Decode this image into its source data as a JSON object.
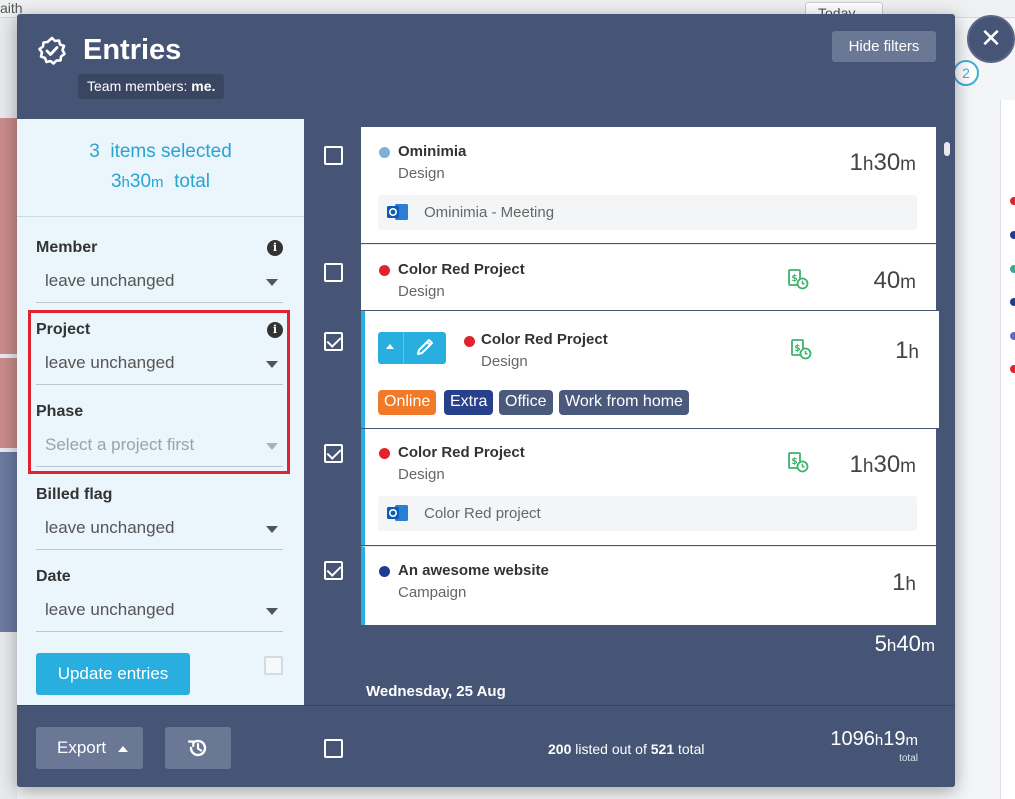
{
  "background": {
    "user_label": "aith",
    "today_label": "Today",
    "badge": "2"
  },
  "modal": {
    "title": "Entries",
    "team_label": "Team members:",
    "team_value": "me.",
    "hide_filters_label": "Hide filters",
    "close_label": "✕"
  },
  "selection": {
    "count": "3",
    "count_label": "items selected",
    "total_h": "3",
    "total_m": "30",
    "total_label": "total"
  },
  "filters": {
    "member": {
      "label": "Member",
      "value": "leave unchanged"
    },
    "project": {
      "label": "Project",
      "value": "leave unchanged"
    },
    "phase": {
      "label": "Phase",
      "placeholder": "Select a project first"
    },
    "billed": {
      "label": "Billed flag",
      "value": "leave unchanged"
    },
    "date": {
      "label": "Date",
      "value": "leave unchanged"
    },
    "update_label": "Update entries"
  },
  "entries": [
    {
      "project": "Ominimia",
      "task": "Design",
      "hours": "1",
      "minutes": "30",
      "color": "#7eb0d9",
      "note": "Ominimia - Meeting",
      "checked": false
    },
    {
      "project": "Color Red Project",
      "task": "Design",
      "hours": "",
      "minutes": "40",
      "color": "#e0232c",
      "checked": false
    },
    {
      "project": "Color Red Project",
      "task": "Design",
      "hours": "1",
      "minutes": "",
      "color": "#e0232c",
      "checked": true,
      "tags": [
        "Online",
        "Extra",
        "Office",
        "Work from home"
      ]
    },
    {
      "project": "Color Red Project",
      "task": "Design",
      "hours": "1",
      "minutes": "30",
      "color": "#e0232c",
      "note": "Color Red project",
      "checked": true
    },
    {
      "project": "An awesome website",
      "task": "Campaign",
      "hours": "1",
      "minutes": "",
      "color": "#1f3a93",
      "checked": true
    }
  ],
  "tag_colors": {
    "Online": "#f07a2a",
    "Extra": "#27408b",
    "Office": "#4b5a7c",
    "Work from home": "#4b5a7c"
  },
  "day_total": {
    "h": "5",
    "m": "40"
  },
  "next_day": "Wednesday, 25 Aug",
  "footer": {
    "export_label": "Export",
    "listed_count": "200",
    "listed_mid": "listed out of",
    "total_count": "521",
    "listed_tail": "total",
    "grand_h": "1096",
    "grand_m": "19",
    "grand_label": "total"
  },
  "units": {
    "h": "h",
    "m": "m"
  }
}
